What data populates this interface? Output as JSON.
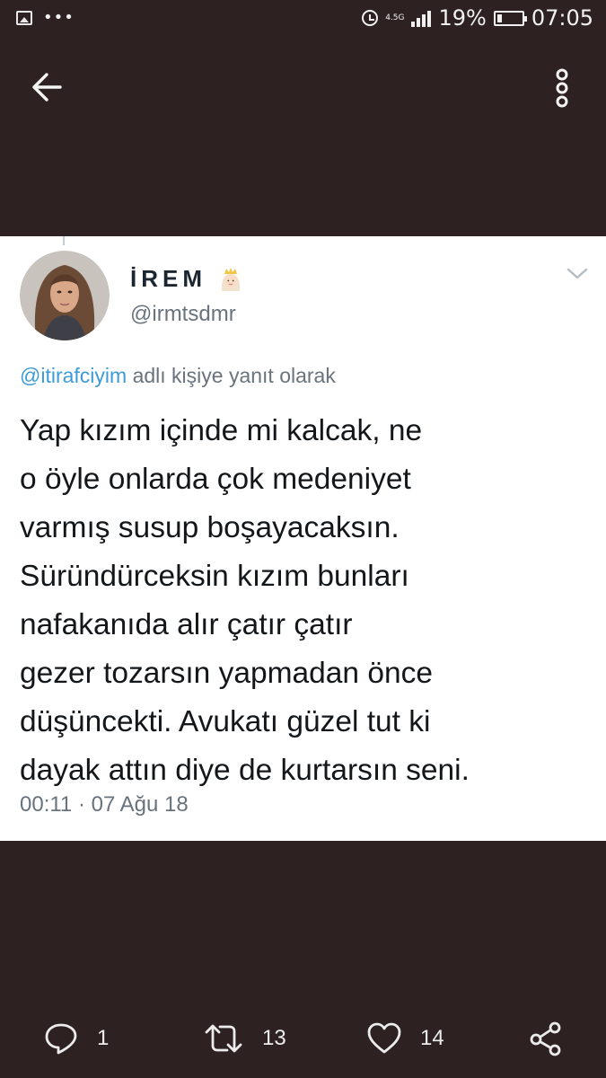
{
  "status_bar": {
    "network": "4.5G",
    "battery": "19%",
    "time": "07:05"
  },
  "nav": {
    "back_icon": "arrow-left-icon",
    "menu_icon": "more-vertical-icon"
  },
  "tweet": {
    "display_name": "İREM",
    "name_emoji": "princess-emoji",
    "handle": "@irmtsdmr",
    "reply_to": "@itirafciyim",
    "reply_suffix": " adlı kişiye yanıt olarak",
    "text": "Yap kızım içinde mi kalcak, ne\no öyle onlarda çok medeniyet\nvarmış susup boşayacaksın.\nSüründürceksin kızım bunları\nnafakanıda alır çatır çatır\ngezer tozarsın yapmadan önce\ndüşüncekti. Avukatı güzel tut ki\ndayak attın diye de kurtarsın seni.",
    "timestamp": "00:11 · 07 Ağu 18"
  },
  "actions": {
    "reply_count": "1",
    "retweet_count": "13",
    "like_count": "14"
  },
  "colors": {
    "background": "#2d2221",
    "card": "#ffffff",
    "link": "#3d9bd6",
    "muted": "#68737d"
  }
}
